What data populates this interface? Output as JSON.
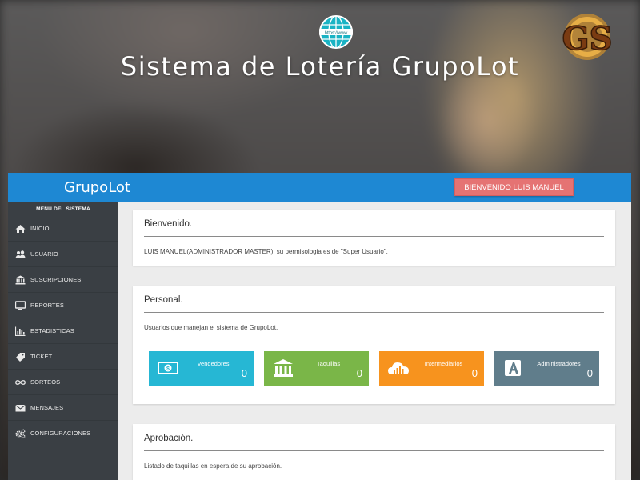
{
  "site_title": "Sistema de Lotería GrupoLot",
  "logos": {
    "globe_text": "https://www",
    "gs_text": "GS"
  },
  "topbar": {
    "brand": "GrupoLot",
    "welcome_button": "BIENVENIDO LUIS MANUEL",
    "color": "#1e88d3"
  },
  "sidebar": {
    "header": "MENU DEL SISTEMA",
    "items": [
      {
        "label": "INICIO",
        "icon": "home-icon"
      },
      {
        "label": "USUARIO",
        "icon": "users-icon"
      },
      {
        "label": "SUSCRIPCIONES",
        "icon": "bank-icon"
      },
      {
        "label": "REPORTES",
        "icon": "monitor-icon"
      },
      {
        "label": "ESTADISTICAS",
        "icon": "bar-chart-icon"
      },
      {
        "label": "TICKET",
        "icon": "ticket-icon"
      },
      {
        "label": "SORTEOS",
        "icon": "infinity-icon"
      },
      {
        "label": "MENSAJES",
        "icon": "envelope-icon"
      },
      {
        "label": "CONFIGURACIONES",
        "icon": "cogs-icon"
      }
    ]
  },
  "welcome_card": {
    "title": "Bienvenido.",
    "text": "LUIS MANUEL(ADMINISTRADOR MASTER), su permisologia es de \"Super Usuario\"."
  },
  "personal_card": {
    "title": "Personal.",
    "text": "Usuarios que manejan el sistema de GrupoLot.",
    "stats": [
      {
        "label": "Vendedores",
        "value": "0",
        "color": "#26b7d4",
        "icon": "money-icon"
      },
      {
        "label": "Taquillas",
        "value": "0",
        "color": "#7ab648",
        "icon": "bank-icon"
      },
      {
        "label": "Intermediarios",
        "value": "0",
        "color": "#f7931e",
        "icon": "cloud-chart-icon"
      },
      {
        "label": "Administradores",
        "value": "0",
        "color": "#607d8b",
        "icon": "letter-a-icon"
      }
    ]
  },
  "approval_card": {
    "title": "Aprobación.",
    "text": "Listado de taquillas en espera de su aprobación."
  }
}
